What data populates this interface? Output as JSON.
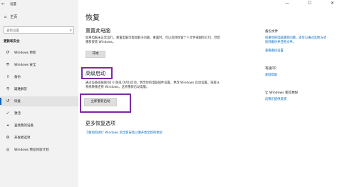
{
  "window": {
    "title": "设置",
    "back_icon": "←",
    "minimize": "—",
    "maximize": "☐",
    "close": "✕"
  },
  "sidebar": {
    "home": {
      "icon": "⌂",
      "label": "主页"
    },
    "search_placeholder": "查找设置",
    "search_icon": "⌕",
    "section": "更新和安全",
    "items": [
      {
        "icon": "⟳",
        "label": "Windows 更新"
      },
      {
        "icon": "⛨",
        "label": "Windows 安全"
      },
      {
        "icon": "⇧",
        "label": "备份"
      },
      {
        "icon": "⚲",
        "label": "疑难解答"
      },
      {
        "icon": "↺",
        "label": "恢复"
      },
      {
        "icon": "✓",
        "label": "激活"
      },
      {
        "icon": "⌖",
        "label": "查找我的设备"
      },
      {
        "icon": "⚙",
        "label": "开发者选项"
      },
      {
        "icon": "◎",
        "label": "Windows 预览体验计划"
      }
    ]
  },
  "main": {
    "title": "恢复",
    "reset": {
      "heading": "重置此电脑",
      "body": "如果电脑未正常运行，重置电脑可能会解决问题。重置时，可以选择保留个人文件或删除它们，然后重新安装 Windows。",
      "button": "开始"
    },
    "advanced": {
      "heading": "高级启动",
      "body": "通过设备或磁盘(如 U 盘或 DVD)启动，更改你的电脑固件设置，更改 Windows 启动设置，或者从系统映像还原 Windows。这将重新启动电脑。",
      "button": "立即重新启动"
    },
    "more": {
      "heading": "更多恢复选项",
      "link": "了解如何进行 Windows 的全新安装以便开始全新的体验"
    }
  },
  "right": {
    "backup_heading": "备份文件",
    "backup_links": [
      "如果你的电脑遇到问题，还可以通过其他方式",
      "找到备份并还原文件。",
      "查看备份设置"
    ],
    "help_heading": "有疑问?",
    "help_link": "获取帮助",
    "improve_heading": "让 Windows 变得更好",
    "improve_link": "向我们提供反馈"
  }
}
